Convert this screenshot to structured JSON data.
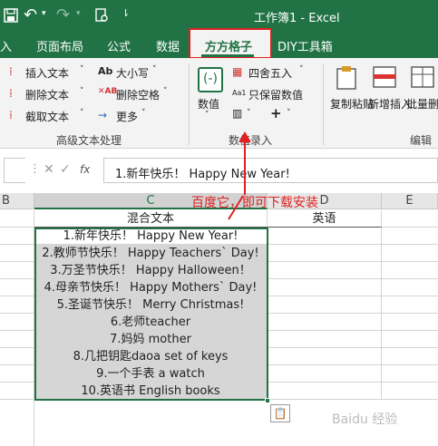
{
  "title": "工作簿1 - Excel",
  "tabs": [
    "入",
    "页面布局",
    "公式",
    "数据",
    "方方格子",
    "DIY工具箱"
  ],
  "active_tab_index": 4,
  "ribbon": {
    "text_group": {
      "items": [
        "插入文本",
        "删除文本",
        "截取文本",
        "大小写",
        "删除空格",
        "更多"
      ],
      "label": "高级文本处理"
    },
    "number_group": {
      "numeric_label": "数值",
      "insert_label": "四舍五入",
      "keep_label": "只保留数值",
      "label": "数值录入"
    },
    "edit_group": {
      "copy_label": "复制粘贴",
      "new_insert_label": "新增插入",
      "batch_delete_label": "批量删除",
      "label": "编辑"
    }
  },
  "formula_bar": {
    "fx": "fx",
    "content": "1.新年快乐！ Happy New Year!"
  },
  "annotation": "百度它，即可下载安装",
  "columns": [
    "B",
    "C",
    "D",
    "E"
  ],
  "header_row": {
    "c": "混合文本",
    "d": "英语"
  },
  "rows": [
    "1.新年快乐！ Happy New Year!",
    "2.教师节快乐！ Happy Teachers` Day!",
    "3.万圣节快乐！ Happy Halloween！",
    "4.母亲节快乐！ Happy Mothers` Day!",
    "5.圣诞节快乐！ Merry Christmas!",
    "6.老师teacher",
    "7.妈妈 mother",
    "8.几把钥匙daoa set of keys",
    "9.一个手表 a watch",
    "10.英语书 English books"
  ],
  "watermark": "Baidu 经验",
  "accent": "#217346",
  "highlight": "#e02020"
}
